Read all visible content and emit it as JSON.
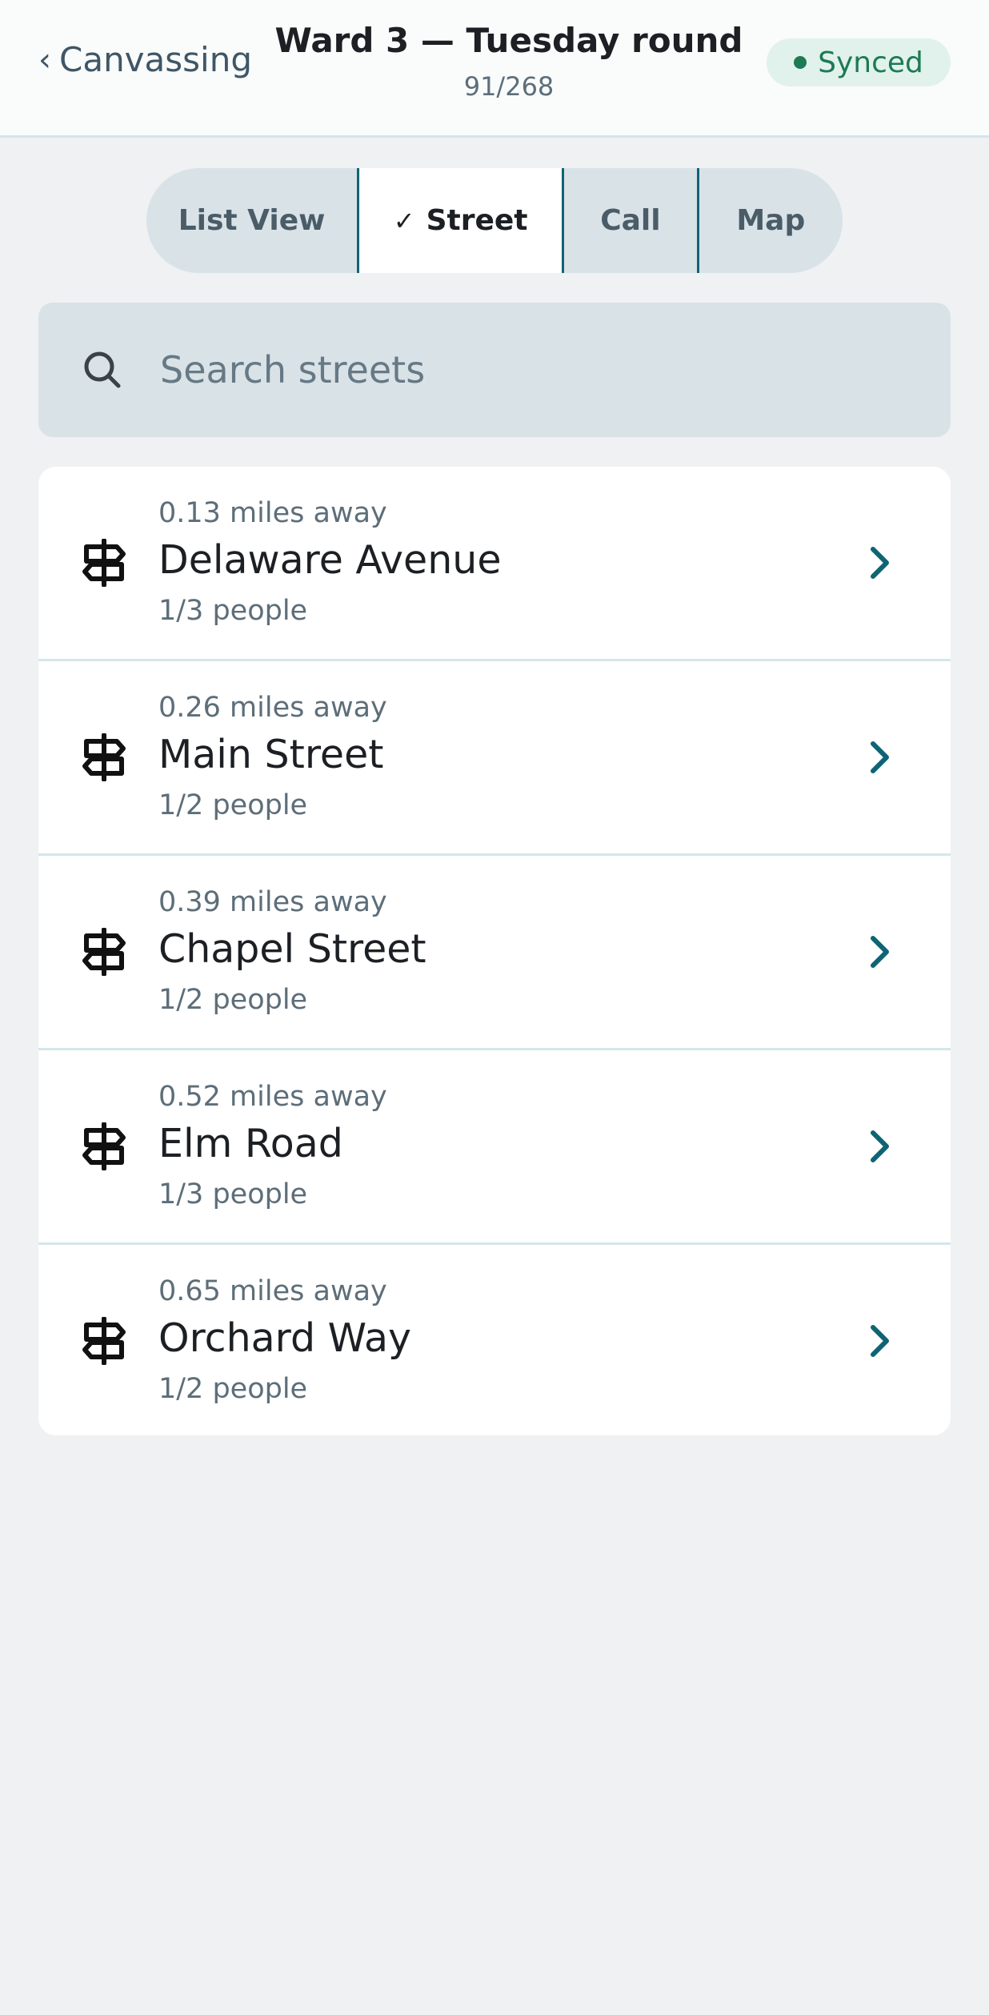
{
  "header": {
    "back_label": "Canvassing",
    "back_chevron": "‹",
    "title": "Ward 3 — Tuesday round",
    "progress": "91/268",
    "sync_status": "Synced",
    "sync_color": "#1d7a55"
  },
  "tabs": [
    {
      "label": "List View",
      "selected": false
    },
    {
      "label": "Street",
      "selected": true,
      "check_glyph": "✓"
    },
    {
      "label": "Call",
      "selected": false
    },
    {
      "label": "Map",
      "selected": false
    }
  ],
  "search": {
    "placeholder": "Search streets",
    "value": "",
    "icon": "search-icon"
  },
  "streets": [
    {
      "distance": "0.13 miles away",
      "name": "Delaware Avenue",
      "people": "1/3 people",
      "icon": "signpost-icon"
    },
    {
      "distance": "0.26 miles away",
      "name": "Main Street",
      "people": "1/2 people",
      "icon": "signpost-icon"
    },
    {
      "distance": "0.39 miles away",
      "name": "Chapel Street",
      "people": "1/2 people",
      "icon": "signpost-icon"
    },
    {
      "distance": "0.52 miles away",
      "name": "Elm Road",
      "people": "1/3 people",
      "icon": "signpost-icon"
    },
    {
      "distance": "0.65 miles away",
      "name": "Orchard Way",
      "people": "1/2 people",
      "icon": "signpost-icon"
    }
  ],
  "colors": {
    "accent": "#0e6474",
    "background": "#eff1f3",
    "synced_badge_bg": "#e1f2ec"
  }
}
